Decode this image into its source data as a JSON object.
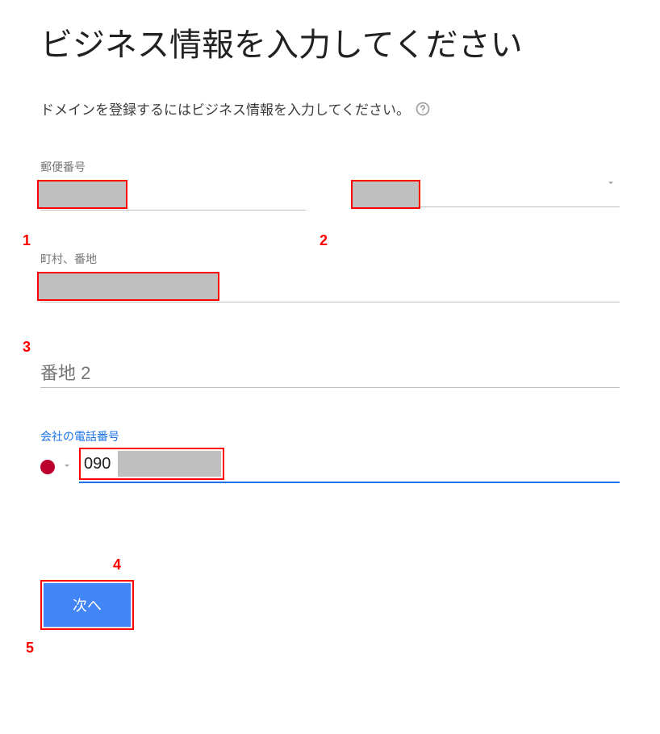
{
  "title": "ビジネス情報を入力してください",
  "subtitle": "ドメインを登録するにはビジネス情報を入力してください。",
  "fields": {
    "postal_label": "郵便番号",
    "address1_label": "町村、番地",
    "address2_placeholder": "番地 2",
    "phone_label": "会社の電話番号",
    "phone_value_visible": "090"
  },
  "buttons": {
    "next": "次へ"
  },
  "markers": {
    "m1": "1",
    "m2": "2",
    "m3": "3",
    "m4": "4",
    "m5": "5"
  }
}
